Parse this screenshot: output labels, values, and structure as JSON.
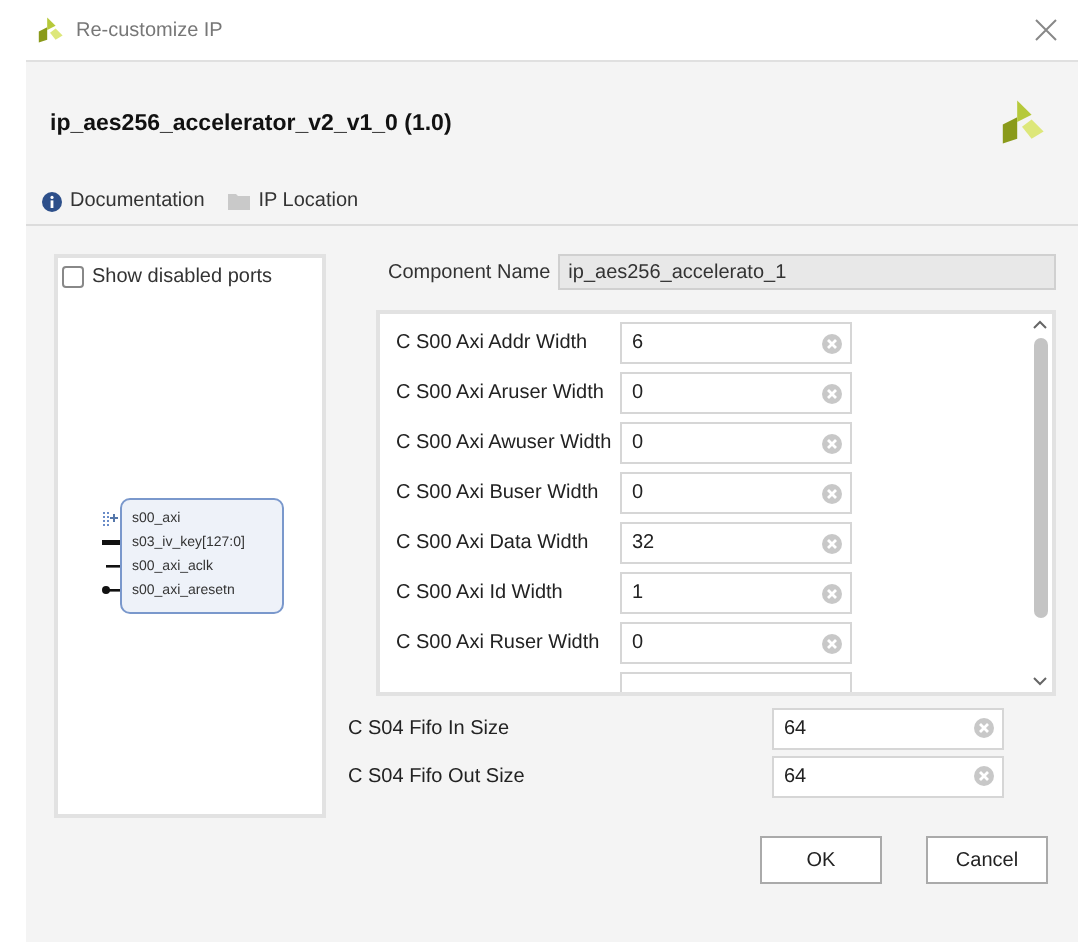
{
  "window": {
    "title": "Re-customize IP"
  },
  "header": {
    "title": "ip_aes256_accelerator_v2_v1_0 (1.0)"
  },
  "links": [
    {
      "kind": "info",
      "label": "Documentation"
    },
    {
      "kind": "folder",
      "label": "IP Location"
    }
  ],
  "symbol_panel": {
    "show_disabled_ports": {
      "label": "Show disabled ports",
      "checked": false
    },
    "ports": [
      {
        "kind": "bus",
        "name": "s00_axi"
      },
      {
        "kind": "vector",
        "name": "s03_iv_key[127:0]"
      },
      {
        "kind": "clock",
        "name": "s00_axi_aclk"
      },
      {
        "kind": "reset",
        "name": "s00_axi_aresetn"
      }
    ]
  },
  "component_name": {
    "label": "Component Name",
    "value": "ip_aes256_accelerato_1"
  },
  "parameters": [
    {
      "label": "C S00 Axi Addr Width",
      "value": "6"
    },
    {
      "label": "C S00 Axi Aruser Width",
      "value": "0"
    },
    {
      "label": "C S00 Axi Awuser Width",
      "value": "0"
    },
    {
      "label": "C S00 Axi Buser Width",
      "value": "0"
    },
    {
      "label": "C S00 Axi Data Width",
      "value": "32"
    },
    {
      "label": "C S00 Axi Id Width",
      "value": "1"
    },
    {
      "label": "C S00 Axi Ruser Width",
      "value": "0"
    }
  ],
  "fifo_parameters": [
    {
      "label": "C S04 Fifo In Size",
      "value": "64"
    },
    {
      "label": "C S04 Fifo Out Size",
      "value": "64"
    }
  ],
  "buttons": [
    {
      "label": "OK"
    },
    {
      "label": "Cancel"
    }
  ]
}
